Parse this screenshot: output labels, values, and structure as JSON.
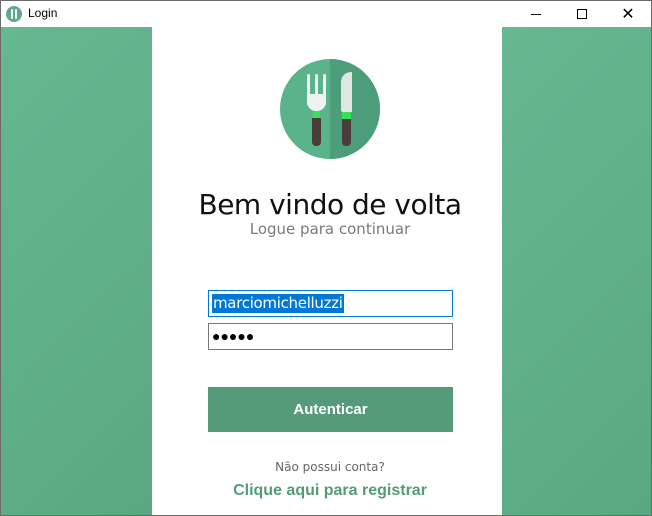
{
  "window": {
    "title": "Login",
    "controls": {
      "minimize": "minimize",
      "maximize": "maximize",
      "close": "✕"
    }
  },
  "colors": {
    "brand": "#559b79",
    "side_panel": "#60b08a",
    "selection": "#0078d7"
  },
  "icons": {
    "app": "fork-knife-icon",
    "logo": "fork-knife-icon"
  },
  "login": {
    "heading": "Bem vindo de volta",
    "subheading": "Logue para continuar",
    "username_value": "marciomichelluzzi",
    "password_mask": "●●●●●",
    "submit_label": "Autenticar",
    "no_account_text": "Não possui conta?",
    "register_link": "Clique aqui para registrar"
  }
}
